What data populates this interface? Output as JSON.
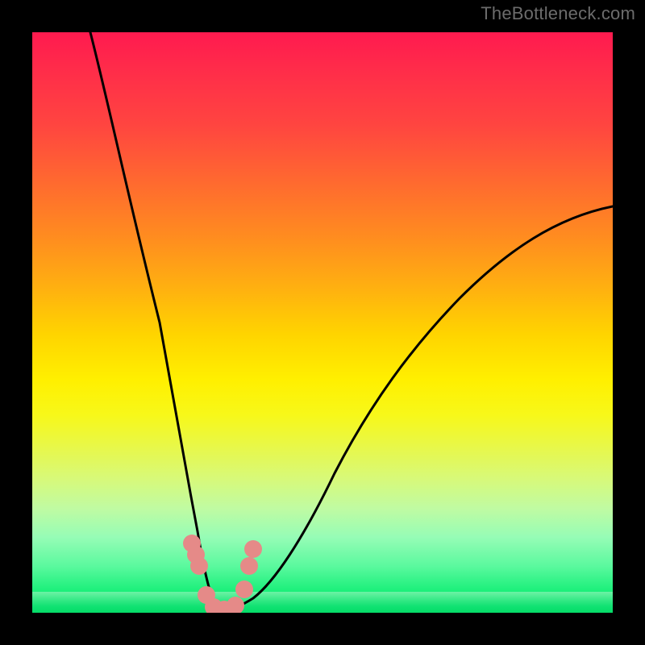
{
  "watermark": "TheBottleneck.com",
  "chart_data": {
    "type": "line",
    "title": "",
    "xlabel": "",
    "ylabel": "",
    "xlim": [
      0,
      100
    ],
    "ylim": [
      0,
      100
    ],
    "series": [
      {
        "name": "curve",
        "x": [
          10,
          14,
          18,
          22,
          25,
          27,
          29,
          30,
          31,
          32,
          33,
          35,
          38,
          42,
          46,
          52,
          58,
          66,
          74,
          82,
          90,
          100
        ],
        "y": [
          100,
          85,
          68,
          50,
          35,
          24,
          14,
          8,
          3,
          1,
          0.5,
          0.5,
          2,
          7,
          14,
          24,
          33,
          43,
          52,
          59,
          65,
          70
        ]
      }
    ],
    "markers": {
      "name": "dots",
      "x": [
        27.5,
        28.2,
        28.8,
        30.0,
        31.2,
        33.0,
        35.0,
        36.5,
        37.3,
        38.0
      ],
      "y": [
        12,
        10,
        8,
        3,
        1,
        0.6,
        1.2,
        4,
        8,
        11
      ]
    },
    "gradient_stops": [
      {
        "pos": 0.0,
        "color": "#ff1a4f"
      },
      {
        "pos": 0.52,
        "color": "#ffd400"
      },
      {
        "pos": 0.72,
        "color": "#e6f84e"
      },
      {
        "pos": 1.0,
        "color": "#05e96b"
      }
    ]
  }
}
